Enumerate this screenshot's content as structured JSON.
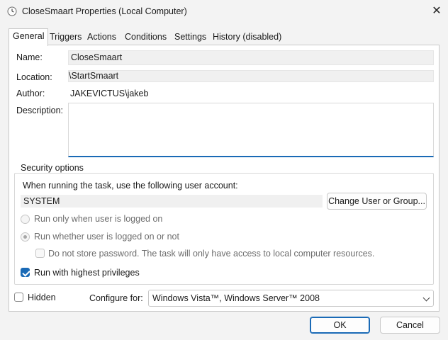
{
  "window": {
    "title": "CloseSmaart Properties (Local Computer)",
    "close_glyph": "✕",
    "icon": "clock-task-icon"
  },
  "tabs": [
    {
      "label": "General",
      "active": true
    },
    {
      "label": "Triggers"
    },
    {
      "label": "Actions"
    },
    {
      "label": "Conditions"
    },
    {
      "label": "Settings"
    },
    {
      "label": "History (disabled)"
    }
  ],
  "general": {
    "name_label": "Name:",
    "name_value": "CloseSmaart",
    "location_label": "Location:",
    "location_value": "\\StartSmaart",
    "author_label": "Author:",
    "author_value": "JAKEVICTUS\\jakeb",
    "description_label": "Description:",
    "description_value": ""
  },
  "security": {
    "legend": "Security options",
    "account_prompt": "When running the task, use the following user account:",
    "account_value": "SYSTEM",
    "change_button": "Change User or Group...",
    "radio_logged_on": "Run only when user is logged on",
    "radio_whether": "Run whether user is logged on or not",
    "no_store_password": "Do not store password.  The task will only have access to local computer resources.",
    "highest_privileges": "Run with highest privileges",
    "highest_privileges_checked": true
  },
  "footer": {
    "hidden_label": "Hidden",
    "configure_label": "Configure for:",
    "configure_value": "Windows Vista™, Windows Server™ 2008",
    "ok_button": "OK",
    "cancel_button": "Cancel"
  },
  "colors": {
    "accent": "#1a6ab6",
    "background": "#f3f3f3",
    "panel": "#ffffff"
  }
}
